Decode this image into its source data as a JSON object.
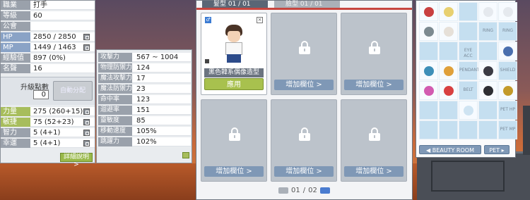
{
  "stats": {
    "job_label": "職業",
    "job_value": "打手",
    "level_label": "等級",
    "level_value": "60",
    "guild_label": "公會",
    "guild_value": "",
    "hp_label": "HP",
    "hp_value": "2850 / 2850",
    "mp_label": "MP",
    "mp_value": "1449 / 1463",
    "exp_label": "經驗值",
    "exp_value": "897 (0%)",
    "fame_label": "名聲",
    "fame_value": "16",
    "ap_title": "升級點數",
    "ap_value": "0",
    "auto_assign": "自動分配",
    "str_label": "力量",
    "str_value": "275 (260+15)",
    "dex_label": "敏捷",
    "dex_value": "75 (52+23)",
    "int_label": "智力",
    "int_value": "5 (4+1)",
    "luk_label": "幸運",
    "luk_value": "5 (4+1)",
    "detail_button": "詳細說明 >"
  },
  "detail": {
    "rows": [
      {
        "label": "攻擊力",
        "value": "567 ~ 1004"
      },
      {
        "label": "物理防禦力",
        "value": "124"
      },
      {
        "label": "魔法攻擊力",
        "value": "17"
      },
      {
        "label": "魔法防禦力",
        "value": "23"
      },
      {
        "label": "命中率",
        "value": "123"
      },
      {
        "label": "迴避率",
        "value": "151"
      },
      {
        "label": "靈敏度",
        "value": "85"
      },
      {
        "label": "移動速度",
        "value": "105%"
      },
      {
        "label": "跳躍力",
        "value": "102%"
      }
    ]
  },
  "beauty": {
    "tab_active": "髮型  01 / 01",
    "tab_inactive": "臉型  01 / 01",
    "gender_icon": "♂",
    "close_icon": "×",
    "character_name": "黑色韓系偶像造型",
    "apply_button": "應用",
    "add_slot_button": "增加欄位 >",
    "page_current": "01",
    "page_sep": "/",
    "page_total": "02"
  },
  "equipment": {
    "slot_labels": [
      "RING",
      "RING",
      "EYE ACC",
      "PENDANT",
      "SHIELD",
      "BELT",
      "PET HP",
      "PET MP"
    ],
    "beauty_room_button": "◀ BEAUTY ROOM",
    "pet_button": "PET ▸",
    "colors": {
      "accent_red": "#c7463f",
      "button_blue": "#7f98b6",
      "button_green": "#a8c14e"
    }
  }
}
